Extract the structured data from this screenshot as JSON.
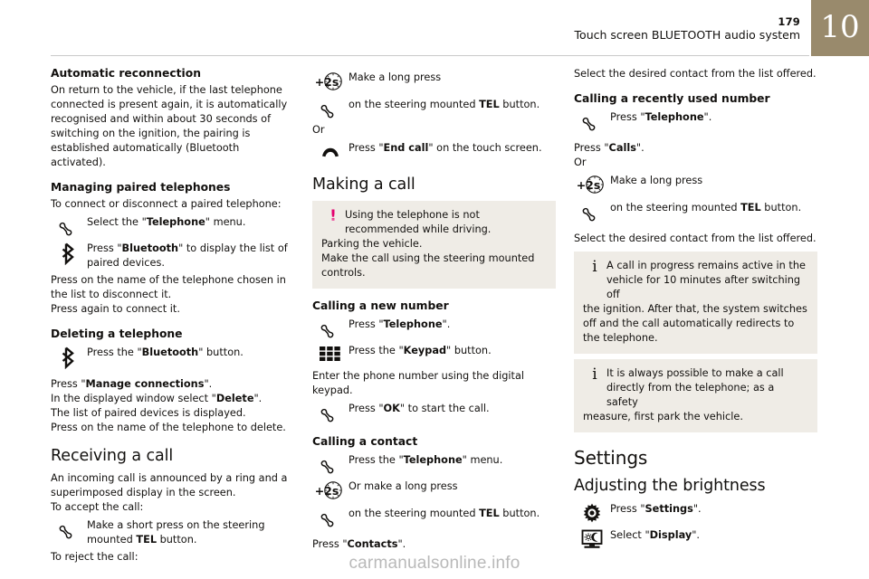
{
  "header": {
    "page_number": "179",
    "title": "Touch screen BLUETOOTH audio system",
    "chapter": "10"
  },
  "footer": {
    "watermark": "carmanualsonline.info"
  },
  "colors": {
    "chapter_box": "#998a6c",
    "callout_bg": "#efece6",
    "warning_accent": "#e4006e",
    "text": "#12100e"
  },
  "col1": {
    "h_automatic_reconnection": "Automatic reconnection",
    "p_automatic_reconnection": "On return to the vehicle, if the last telephone connected is present again, it is automatically recognised and within about 30 seconds of switching on the ignition, the pairing is established automatically (Bluetooth activated).",
    "h_managing_paired": "Managing paired telephones",
    "p_managing_intro": "To connect or disconnect a paired telephone:",
    "r_select_telephone_pre": "Select the \"",
    "r_select_telephone_bold": "Telephone",
    "r_select_telephone_post": "\" menu.",
    "r_press_bluetooth_pre": "Press \"",
    "r_press_bluetooth_bold": "Bluetooth",
    "r_press_bluetooth_post": "\" to display the list of paired devices.",
    "p_press_name_disconnect": "Press on the name of the telephone chosen in the list to disconnect it.",
    "p_press_again_connect": "Press again to connect it.",
    "h_deleting": "Deleting a telephone",
    "r_press_bluetooth_btn_pre": "Press the \"",
    "r_press_bluetooth_btn_bold": "Bluetooth",
    "r_press_bluetooth_btn_post": "\" button.",
    "p_manage_connections_pre": "Press \"",
    "p_manage_connections_bold": "Manage connections",
    "p_manage_connections_post": "\".",
    "p_select_delete_pre": "In the displayed window select \"",
    "p_select_delete_bold": "Delete",
    "p_select_delete_post": "\".",
    "p_list_displayed": "The list of paired devices is displayed.",
    "p_press_name_delete": "Press on the name of the telephone to delete.",
    "h_receiving": "Receiving a call",
    "p_incoming": "An incoming call is announced by a ring and a superimposed display in the screen.",
    "p_accept": "To accept the call:",
    "r_short_press_pre": "Make a short press on the steering mounted ",
    "r_short_press_bold": "TEL",
    "r_short_press_post": " button.",
    "p_reject": "To reject the call:"
  },
  "col2": {
    "r_long_press": "Make a long press",
    "r_tel_button_pre": "on the steering mounted ",
    "r_tel_button_bold": "TEL",
    "r_tel_button_post": " button.",
    "p_or": "Or",
    "r_end_call_pre": "Press \"",
    "r_end_call_bold": "End call",
    "r_end_call_post": "\" on the touch screen.",
    "h_making_a_call": "Making a call",
    "warn_text": "Using the telephone is not recommended while driving.",
    "warn_cont_1": "Parking the vehicle.",
    "warn_cont_2": "Make the call using the steering mounted controls.",
    "h_calling_new_number": "Calling a new number",
    "r_press_telephone_pre": "Press \"",
    "r_press_telephone_bold": "Telephone",
    "r_press_telephone_post": "\".",
    "r_press_keypad_pre": "Press the \"",
    "r_press_keypad_bold": "Keypad",
    "r_press_keypad_post": "\" button.",
    "p_enter_number": "Enter the phone number using the digital keypad.",
    "r_press_ok_pre": "Press \"",
    "r_press_ok_bold": "OK",
    "r_press_ok_post": "\" to start the call.",
    "h_calling_contact": "Calling a contact",
    "r_press_telephone_menu_pre": "Press the \"",
    "r_press_telephone_menu_bold": "Telephone",
    "r_press_telephone_menu_post": "\" menu.",
    "r_or_long_press": "Or make a long press",
    "r_tel_button2_pre": "on the steering mounted ",
    "r_tel_button2_bold": "TEL",
    "r_tel_button2_post": " button.",
    "p_press_contacts_pre": "Press \"",
    "p_press_contacts_bold": "Contacts",
    "p_press_contacts_post": "\"."
  },
  "col3": {
    "p_select_contact_1": "Select the desired contact from the list offered.",
    "h_calling_recent": "Calling a recently used number",
    "r_press_telephone_pre": "Press \"",
    "r_press_telephone_bold": "Telephone",
    "r_press_telephone_post": "\".",
    "p_press_calls_pre": "Press \"",
    "p_press_calls_bold": "Calls",
    "p_press_calls_post": "\".",
    "p_or": "Or",
    "r_long_press": "Make a long press",
    "r_tel_button_pre": "on the steering mounted ",
    "r_tel_button_bold": "TEL",
    "r_tel_button_post": " button.",
    "p_select_contact_2": "Select the desired contact from the list offered.",
    "info1_text": "A call in progress remains active in the vehicle for 10 minutes after switching off",
    "info1_cont": "the ignition. After that, the system switches off and the call automatically redirects to the telephone.",
    "info2_text": "It is always possible to make a call directly from the telephone; as a safety",
    "info2_cont": "measure, first park the vehicle.",
    "h_settings": "Settings",
    "h_brightness": "Adjusting the brightness",
    "r_press_settings_pre": "Press \"",
    "r_press_settings_bold": "Settings",
    "r_press_settings_post": "\".",
    "r_select_display_pre": "Select \"",
    "r_select_display_bold": "Display",
    "r_select_display_post": "\"."
  },
  "icons": {
    "phone_handset": "phone-handset-icon",
    "phone_hangup": "phone-hangup-icon",
    "bluetooth": "bluetooth-icon",
    "long_press": "+2s",
    "keypad": "keypad-icon",
    "gear": "gear-icon",
    "display": "display-brightness-icon",
    "warning": "!",
    "info": "i"
  }
}
